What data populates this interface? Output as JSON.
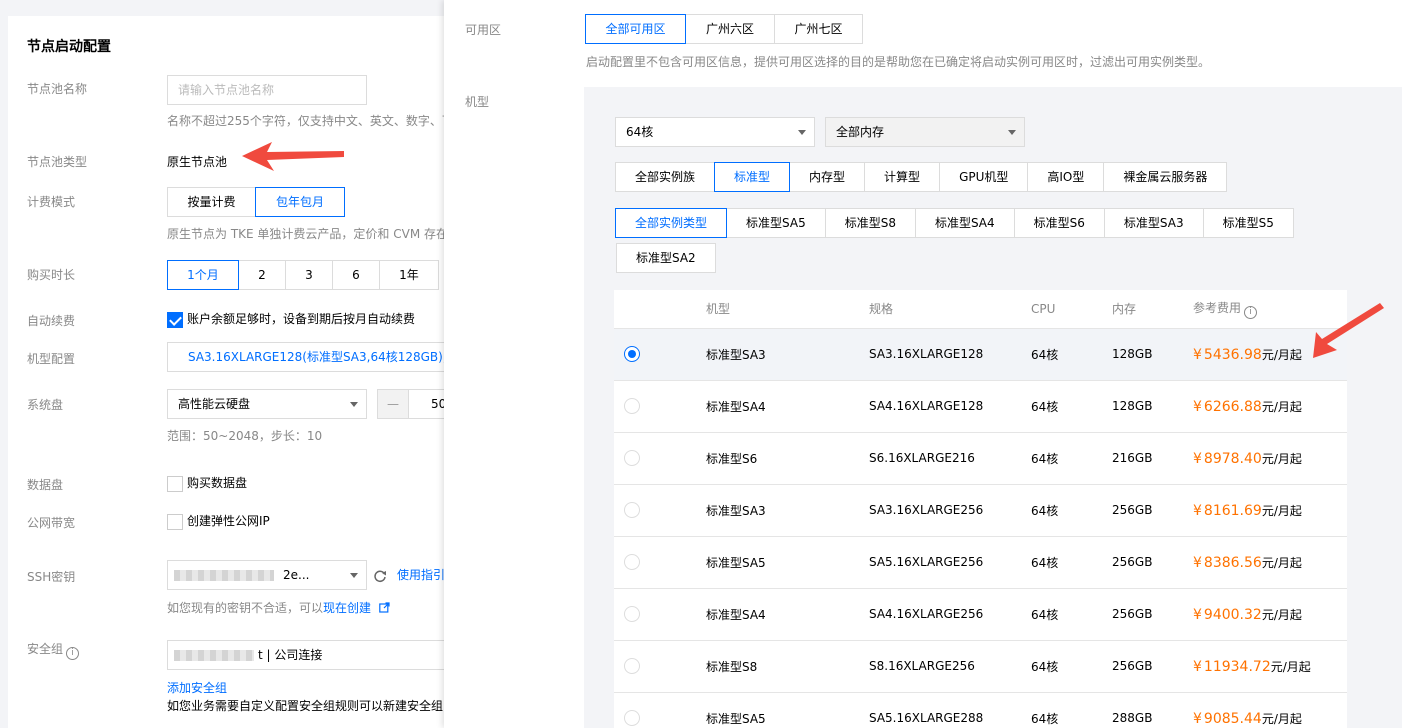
{
  "left": {
    "title": "节点启动配置",
    "pool_name": {
      "label": "节点池名称",
      "placeholder": "请输入节点池名称",
      "hint": "名称不超过255个字符，仅支持中文、英文、数字、下"
    },
    "pool_type": {
      "label": "节点池类型",
      "value": "原生节点池"
    },
    "billing": {
      "label": "计费模式",
      "options": [
        "按量计费",
        "包年包月"
      ],
      "selected": "包年包月",
      "hint": "原生节点为 TKE 单独计费云产品，定价和 CVM 存在"
    },
    "duration": {
      "label": "购买时长",
      "options": [
        "1个月",
        "2",
        "3",
        "6",
        "1年"
      ],
      "selected": "1个月"
    },
    "auto_renew": {
      "label": "自动续费",
      "checked": true,
      "text": "账户余额足够时，设备到期后按月自动续费"
    },
    "model_config": {
      "label": "机型配置",
      "value": "SA3.16XLARGE128(标准型SA3,64核128GB);"
    },
    "system_disk": {
      "label": "系统盘",
      "type": "高性能云硬盘",
      "size": "50",
      "hint": "范围：50~2048，步长：10",
      "minus": "—"
    },
    "data_disk": {
      "label": "数据盘",
      "text": "购买数据盘"
    },
    "bandwidth": {
      "label": "公网带宽",
      "text": "创建弹性公网IP"
    },
    "ssh": {
      "label": "SSH密钥",
      "value_suffix": "2e...",
      "guide_link": "使用指引",
      "hint_prefix": "如您现有的密钥不合适，可以",
      "hint_link": "现在创建"
    },
    "security_group": {
      "label": "安全组",
      "value_suffix": "t | 公司连接",
      "add_link": "添加安全组",
      "hint": "如您业务需要自定义配置安全组规则可以新建安全组,"
    }
  },
  "right": {
    "zone": {
      "label": "可用区",
      "options": [
        "全部可用区",
        "广州六区",
        "广州七区"
      ],
      "selected": "全部可用区",
      "hint": "启动配置里不包含可用区信息，提供可用区选择的目的是帮助您在已确定将启动实例可用区时，过滤出可用实例类型。"
    },
    "model_label": "机型",
    "filter_cpu": "64核",
    "filter_mem": "全部内存",
    "families": [
      "全部实例族",
      "标准型",
      "内存型",
      "计算型",
      "GPU机型",
      "高IO型",
      "裸金属云服务器"
    ],
    "family_selected": "标准型",
    "types": [
      "全部实例类型",
      "标准型SA5",
      "标准型S8",
      "标准型SA4",
      "标准型S6",
      "标准型SA3",
      "标准型S5",
      "标准型SA2"
    ],
    "type_selected": "全部实例类型",
    "table": {
      "headers": [
        "机型",
        "规格",
        "CPU",
        "内存",
        "参考费用"
      ],
      "unit": "元/月起",
      "currency": "¥",
      "rows": [
        {
          "model": "标准型SA3",
          "spec": "SA3.16XLARGE128",
          "cpu": "64核",
          "mem": "128GB",
          "price": "5436.98",
          "selected": true
        },
        {
          "model": "标准型SA4",
          "spec": "SA4.16XLARGE128",
          "cpu": "64核",
          "mem": "128GB",
          "price": "6266.88"
        },
        {
          "model": "标准型S6",
          "spec": "S6.16XLARGE216",
          "cpu": "64核",
          "mem": "216GB",
          "price": "8978.40"
        },
        {
          "model": "标准型SA3",
          "spec": "SA3.16XLARGE256",
          "cpu": "64核",
          "mem": "256GB",
          "price": "8161.69"
        },
        {
          "model": "标准型SA5",
          "spec": "SA5.16XLARGE256",
          "cpu": "64核",
          "mem": "256GB",
          "price": "8386.56"
        },
        {
          "model": "标准型SA4",
          "spec": "SA4.16XLARGE256",
          "cpu": "64核",
          "mem": "256GB",
          "price": "9400.32"
        },
        {
          "model": "标准型S8",
          "spec": "S8.16XLARGE256",
          "cpu": "64核",
          "mem": "256GB",
          "price": "11934.72"
        },
        {
          "model": "标准型SA5",
          "spec": "SA5.16XLARGE288",
          "cpu": "64核",
          "mem": "288GB",
          "price": "9085.44"
        }
      ]
    }
  },
  "colors": {
    "accent": "#006eff",
    "price": "#ff7200",
    "annotation_arrow": "#f04a3e"
  }
}
